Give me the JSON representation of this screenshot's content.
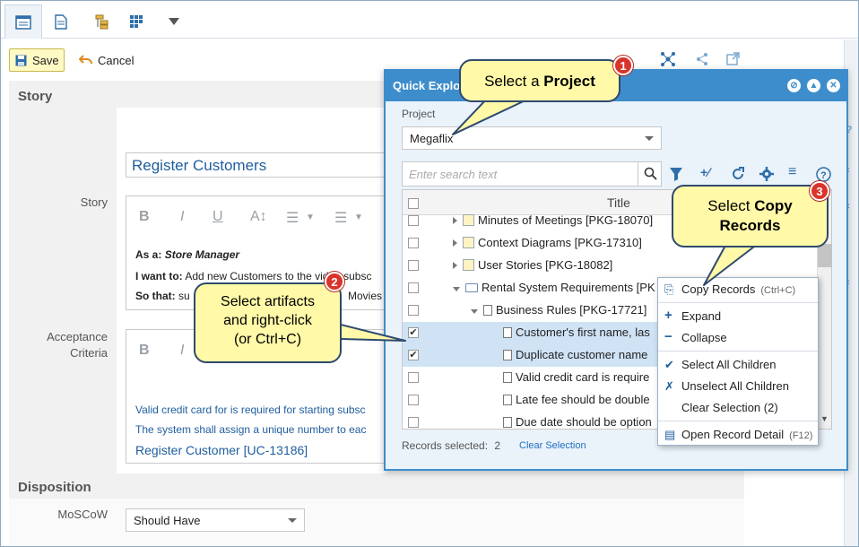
{
  "tabs": [
    "details-tab",
    "document-tab",
    "relations-tab",
    "grid-tab",
    "more-tab"
  ],
  "actions": {
    "save": "Save",
    "cancel": "Cancel"
  },
  "story_section": {
    "title": "Story",
    "name_value": "Register Customers",
    "story_label": "Story",
    "story_lines": {
      "as_a_label": "As a:",
      "as_a_value": "Store Manager",
      "i_want_label": "I want to:",
      "i_want_value": "Add new Customers to the video subsc",
      "so_that_label": "So that:",
      "so_that_value": "su",
      "so_that_tail": "Movies"
    },
    "acceptance_label": "Acceptance Criteria",
    "acceptance_lines": [
      "Valid credit card for is required for starting subsc",
      "The system shall assign a unique number to eac"
    ],
    "acceptance_link": "Register Customer [UC-13186]"
  },
  "disposition": {
    "title": "Disposition",
    "moscow_label": "MoSCoW",
    "moscow_value": "Should Have"
  },
  "quick_explorer": {
    "title": "Quick Explo",
    "project_label": "Project",
    "project_value": "Megaflix",
    "search_placeholder": "Enter search text",
    "column_title": "Title",
    "rows": [
      {
        "text": "Minutes of Meetings [PKG-18070]",
        "level": 1,
        "expander": "right",
        "icon": "pkg",
        "checked": false,
        "selected": false
      },
      {
        "text": "Context Diagrams [PKG-17310]",
        "level": 1,
        "expander": "right",
        "icon": "pkg",
        "checked": false,
        "selected": false
      },
      {
        "text": "User Stories [PKG-18082]",
        "level": 1,
        "expander": "right",
        "icon": "pkg",
        "checked": false,
        "selected": false
      },
      {
        "text": "Rental System Requirements [PK",
        "level": 1,
        "expander": "down",
        "icon": "folder",
        "checked": false,
        "selected": false
      },
      {
        "text": "Business Rules [PKG-17721]",
        "level": 2,
        "expander": "down",
        "icon": "doc",
        "checked": false,
        "selected": false
      },
      {
        "text": "Customer's first name, las",
        "level": 3,
        "expander": "",
        "icon": "doc",
        "checked": true,
        "selected": true
      },
      {
        "text": "Duplicate customer name",
        "level": 3,
        "expander": "",
        "icon": "doc",
        "checked": true,
        "selected": true
      },
      {
        "text": "Valid credit card is require",
        "level": 3,
        "expander": "",
        "icon": "doc",
        "checked": false,
        "selected": false
      },
      {
        "text": "Late fee should be double",
        "level": 3,
        "expander": "",
        "icon": "doc",
        "checked": false,
        "selected": false
      },
      {
        "text": "Due date should be option",
        "level": 3,
        "expander": "",
        "icon": "doc",
        "checked": false,
        "selected": false
      }
    ],
    "records_selected_label": "Records selected:",
    "records_selected_count": "2",
    "clear_selection": "Clear Selection"
  },
  "context_menu": {
    "copy_records": "Copy Records",
    "copy_shortcut": "(Ctrl+C)",
    "expand": "Expand",
    "collapse": "Collapse",
    "select_all_children": "Select All Children",
    "unselect_all_children": "Unselect All Children",
    "clear_selection": "Clear Selection (2)",
    "open_record_detail": "Open Record Detail",
    "open_shortcut": "(F12)"
  },
  "callouts": {
    "c1_prefix": "Select a ",
    "c1_bold": "Project",
    "c1_num": "1",
    "c2_line1": "Select artifacts",
    "c2_line2": "and right-click",
    "c2_line3": "(or Ctrl+C)",
    "c2_num": "2",
    "c3_prefix": "Select ",
    "c3_bold1": "Copy",
    "c3_bold2": "Records",
    "c3_num": "3"
  },
  "colors": {
    "accent": "#3d8dcc",
    "callout": "#fff9a8",
    "badge": "#d9342b",
    "link": "#1f5d9e"
  }
}
